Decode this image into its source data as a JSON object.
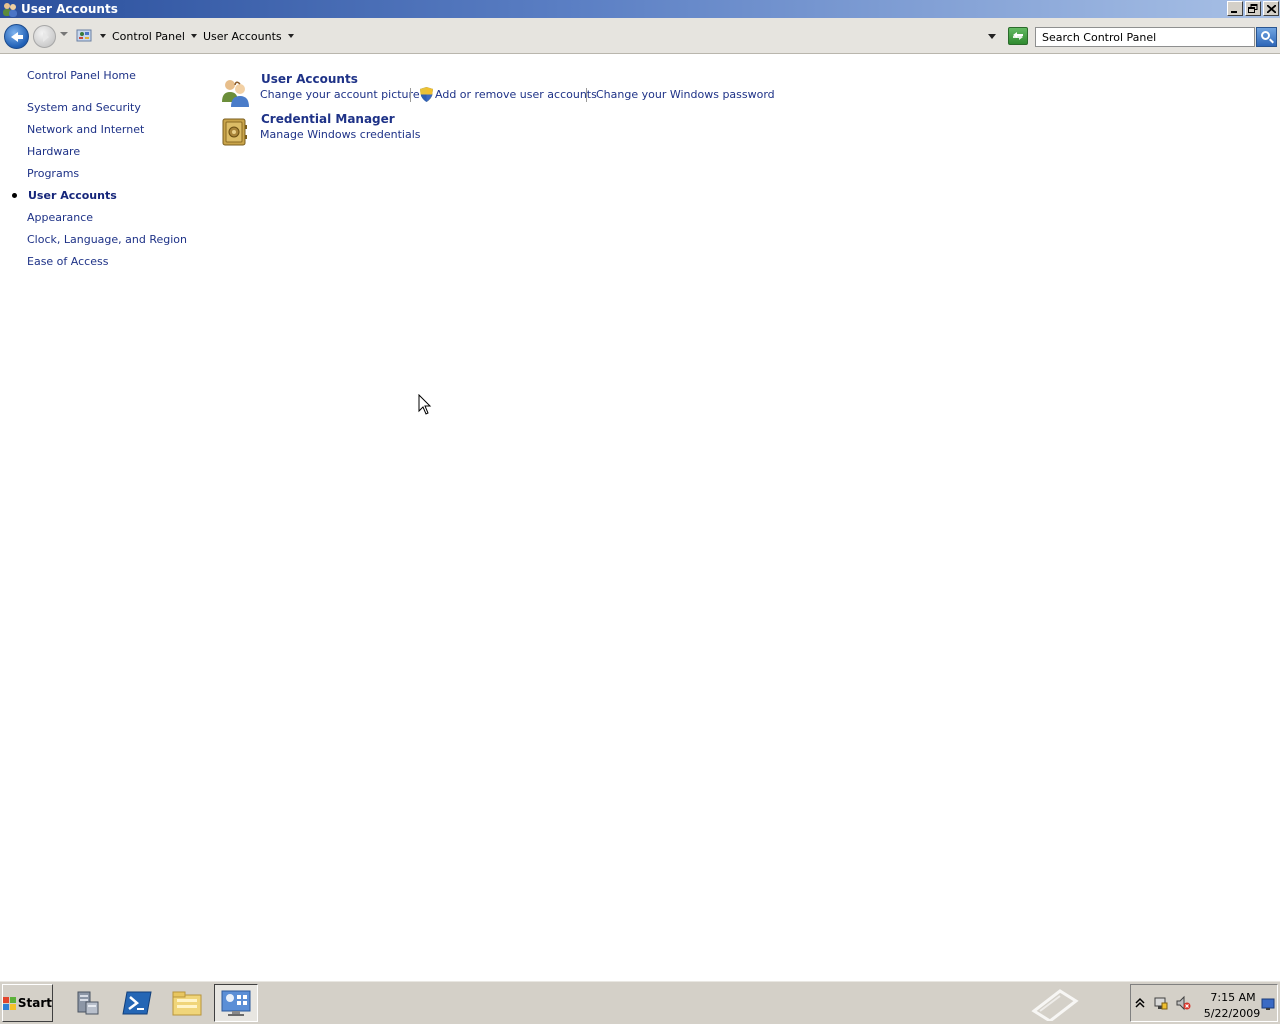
{
  "window": {
    "title": "User Accounts",
    "controls": [
      "minimize",
      "restore",
      "close"
    ]
  },
  "address_bar": {
    "breadcrumbs": [
      "Control Panel",
      "User Accounts"
    ],
    "search": {
      "placeholder": "Search Control Panel"
    },
    "back_icon": "back-arrow-icon",
    "forward_icon": "forward-arrow-icon",
    "refresh_icon": "refresh-icon",
    "search_icon": "search-icon"
  },
  "left_nav": {
    "home": "Control Panel Home",
    "items": [
      {
        "label": "System and Security",
        "current": false
      },
      {
        "label": "Network and Internet",
        "current": false
      },
      {
        "label": "Hardware",
        "current": false
      },
      {
        "label": "Programs",
        "current": false
      },
      {
        "label": "User Accounts",
        "current": true
      },
      {
        "label": "Appearance",
        "current": false
      },
      {
        "label": "Clock, Language, and Region",
        "current": false
      },
      {
        "label": "Ease of Access",
        "current": false
      }
    ]
  },
  "categories": [
    {
      "title": "User Accounts",
      "icon": "users-icon",
      "tasks": [
        "Change your account picture",
        "Add or remove user accounts",
        "Change your Windows password"
      ]
    },
    {
      "title": "Credential Manager",
      "icon": "vault-icon",
      "tasks": [
        "Manage Windows credentials"
      ]
    }
  ],
  "taskbar": {
    "start_label": "Start",
    "items": [
      "server-manager-icon",
      "powershell-icon",
      "explorer-icon",
      "control-panel-icon"
    ],
    "tray": {
      "time": "7:15 AM",
      "date": "5/22/2009"
    }
  },
  "colors": {
    "link": "#1e3287",
    "titlebar_start": "#2a4f9c",
    "taskbar": "#d4d0c8"
  }
}
